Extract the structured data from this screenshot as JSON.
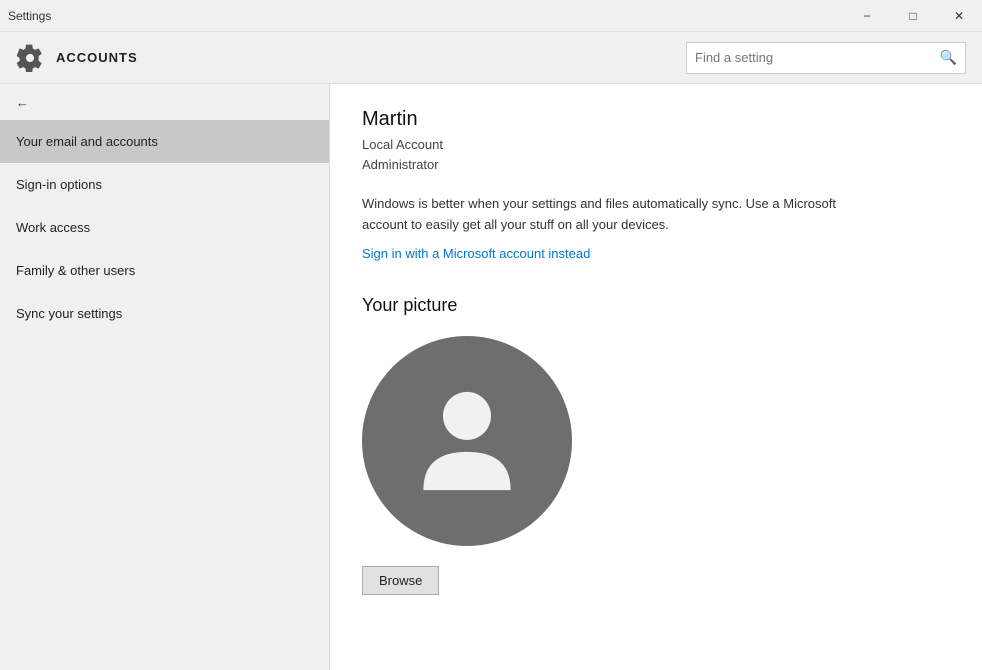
{
  "titlebar": {
    "app_name": "Settings",
    "minimize_label": "−",
    "maximize_label": "□",
    "close_label": "✕"
  },
  "header": {
    "icon": "⚙",
    "title": "ACCOUNTS",
    "search_placeholder": "Find a setting",
    "search_icon": "🔍"
  },
  "sidebar": {
    "back_label": "←",
    "nav_items": [
      {
        "id": "email-accounts",
        "label": "Your email and accounts",
        "active": true
      },
      {
        "id": "sign-in-options",
        "label": "Sign-in options",
        "active": false
      },
      {
        "id": "work-access",
        "label": "Work access",
        "active": false
      },
      {
        "id": "family-other-users",
        "label": "Family & other users",
        "active": false
      },
      {
        "id": "sync-settings",
        "label": "Sync your settings",
        "active": false
      }
    ]
  },
  "content": {
    "user_name": "Martin",
    "account_type": "Local Account",
    "account_role": "Administrator",
    "sync_message": "Windows is better when your settings and files automatically sync. Use a Microsoft account to easily get all your stuff on all your devices.",
    "sign_in_link": "Sign in with a Microsoft account instead",
    "picture_section_title": "Your picture",
    "browse_button_label": "Browse"
  }
}
